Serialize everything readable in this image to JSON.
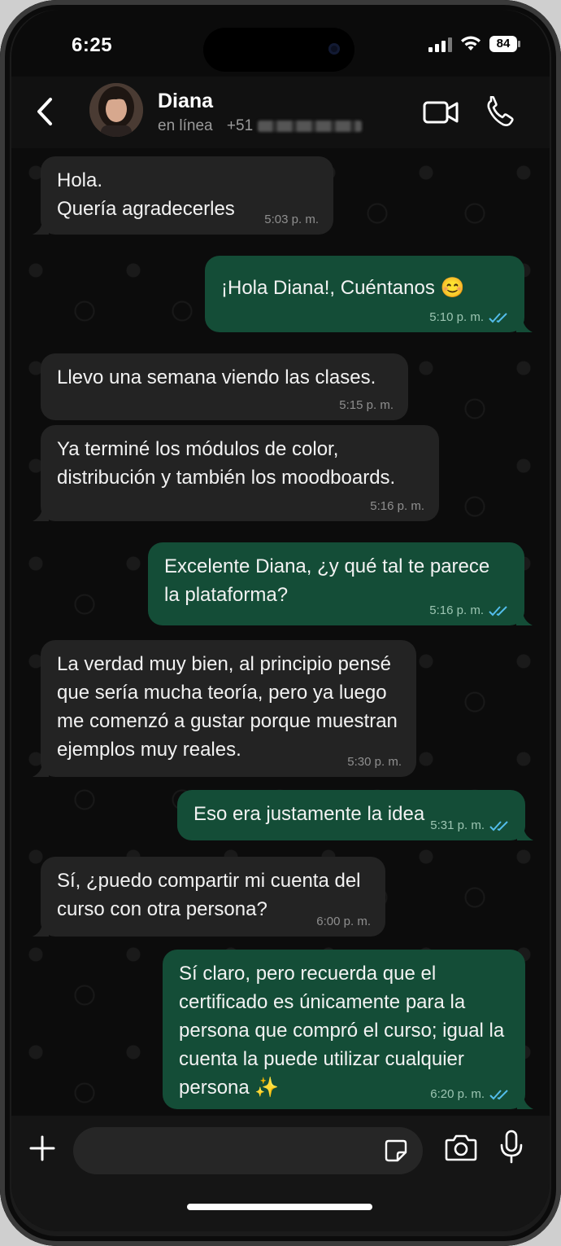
{
  "status_bar": {
    "time": "6:25",
    "battery": "84"
  },
  "header": {
    "back_icon": "chevron-left-icon",
    "contact_name": "Diana",
    "status": "en línea",
    "phone_prefix": "+51",
    "video_icon": "video-camera-icon",
    "call_icon": "phone-icon"
  },
  "messages": [
    {
      "dir": "in",
      "text": "Hola.\nQuería agradecerles",
      "time": "5:03 p. m."
    },
    {
      "dir": "out",
      "text": "¡Hola Diana!, Cuéntanos 😊",
      "time": "5:10 p. m."
    },
    {
      "dir": "in",
      "text": "Llevo una semana viendo las clases.",
      "time": "5:15 p. m."
    },
    {
      "dir": "in",
      "text": "Ya terminé los módulos de color,\ndistribución y también los moodboards.",
      "time": "5:16 p. m."
    },
    {
      "dir": "out",
      "text": "Excelente Diana, ¿y qué tal te parece\nla plataforma?",
      "time": "5:16 p. m."
    },
    {
      "dir": "in",
      "text": "La verdad muy bien, al principio pensé\nque sería mucha teoría, pero ya luego\nme comenzó a gustar porque muestran\nejemplos muy reales.",
      "time": "5:30 p. m."
    },
    {
      "dir": "out",
      "text": "Eso era justamente la idea",
      "time": "5:31 p. m."
    },
    {
      "dir": "in",
      "text": "Sí, ¿puedo compartir mi cuenta del\ncurso con otra persona?",
      "time": "6:00 p. m."
    },
    {
      "dir": "out",
      "text": "Sí claro, pero recuerda que el\ncertificado es únicamente para la\npersona que compró el curso; igual la\ncuenta la puede utilizar cualquier\npersona ✨",
      "time": "6:20 p. m."
    }
  ],
  "composer": {
    "plus_icon": "plus-icon",
    "sticker_icon": "sticker-icon",
    "camera_icon": "camera-icon",
    "mic_icon": "microphone-icon"
  },
  "colors": {
    "incoming_bubble": "#232323",
    "outgoing_bubble": "#144d37",
    "read_tick": "#53bdeb"
  }
}
